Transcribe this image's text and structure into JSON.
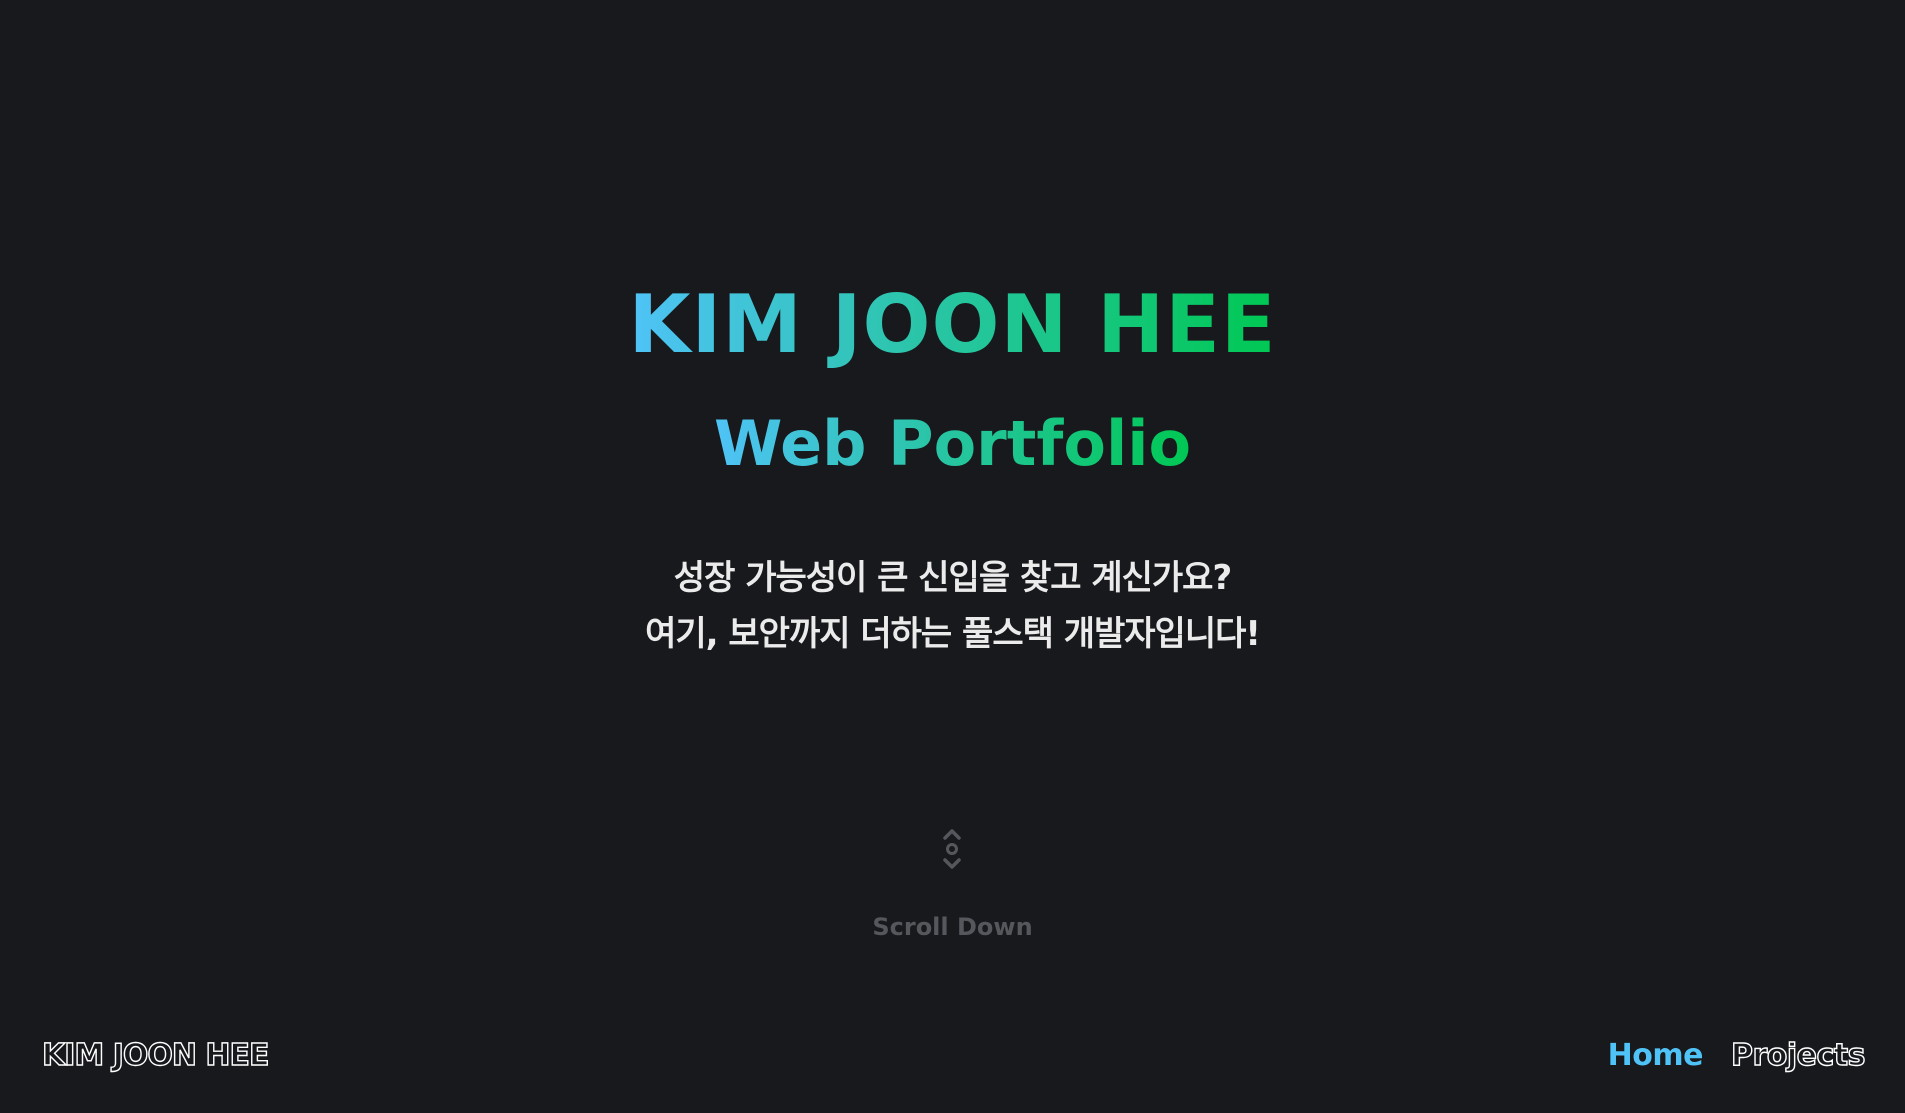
{
  "hero": {
    "name": "KIM JOON HEE",
    "subtitle": "Web Portfolio",
    "intro_line1": "성장 가능성이 큰 신입을 찾고 계신가요?",
    "intro_line2": "여기, 보안까지 더하는 풀스택 개발자입니다!"
  },
  "scroll": {
    "icon": "scroll-arrows-icon",
    "label": "Scroll Down"
  },
  "footer": {
    "brand": "KIM JOON HEE"
  },
  "nav": {
    "items": [
      {
        "label": "Home",
        "active": true
      },
      {
        "label": "Projects",
        "active": false
      }
    ]
  },
  "colors": {
    "background": "#18191d",
    "gradient_start": "#4fc3f7",
    "gradient_end": "#00c853",
    "active_nav": "#4fc3f7",
    "muted_text": "#55575c"
  }
}
